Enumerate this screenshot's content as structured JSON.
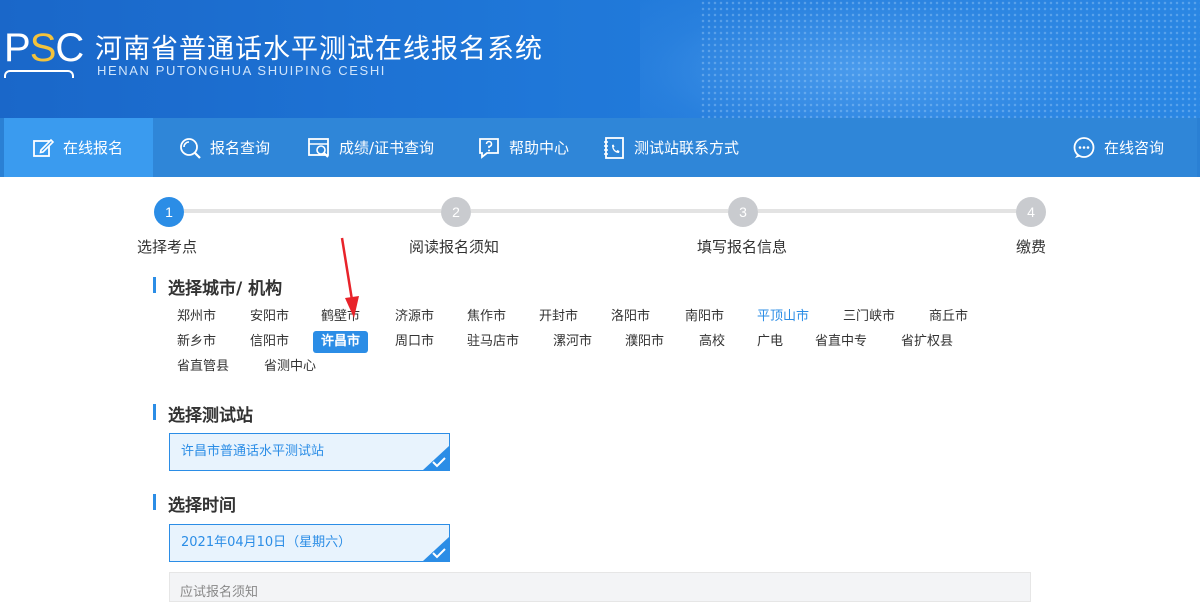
{
  "header": {
    "logo_text_p": "P",
    "logo_text_s": "S",
    "logo_text_c": "C",
    "title_cn": "河南省普通话水平测试在线报名系统",
    "title_en": "HENAN PUTONGHUA SHUIPING CESHI"
  },
  "nav": {
    "items": [
      {
        "label": "在线报名",
        "icon": "edit-icon"
      },
      {
        "label": "报名查询",
        "icon": "search-icon"
      },
      {
        "label": "成绩/证书查询",
        "icon": "certificate-search-icon"
      },
      {
        "label": "帮助中心",
        "icon": "help-icon"
      },
      {
        "label": "测试站联系方式",
        "icon": "contact-card-icon"
      }
    ],
    "consult": {
      "label": "在线咨询",
      "icon": "chat-icon"
    }
  },
  "steps": [
    {
      "num": "1",
      "label": "选择考点"
    },
    {
      "num": "2",
      "label": "阅读报名须知"
    },
    {
      "num": "3",
      "label": "填写报名信息"
    },
    {
      "num": "4",
      "label": "缴费"
    }
  ],
  "sections": {
    "city_title": "选择城市/ 机构",
    "station_title": "选择测试站",
    "time_title": "选择时间"
  },
  "cities": {
    "row1": [
      "郑州市",
      "安阳市",
      "鹤壁市",
      "济源市",
      "焦作市",
      "开封市",
      "洛阳市",
      "南阳市",
      "平顶山市",
      "三门峡市",
      "商丘市"
    ],
    "row2": [
      "新乡市",
      "信阳市",
      "许昌市",
      "周口市",
      "驻马店市",
      "漯河市",
      "濮阳市",
      "高校",
      "广电",
      "省直中专",
      "省扩权县"
    ],
    "row3": [
      "省直管县",
      "省测中心"
    ],
    "selected": "许昌市",
    "highlight": "平顶山市"
  },
  "station": {
    "value": "许昌市普通话水平测试站"
  },
  "time": {
    "value": "2021年04月10日（星期六）"
  },
  "bottom": {
    "text": "应试报名须知"
  },
  "colors": {
    "primary": "#2b8de6",
    "header_bg": "#1f77d8",
    "annotation_arrow": "#e8232a"
  }
}
